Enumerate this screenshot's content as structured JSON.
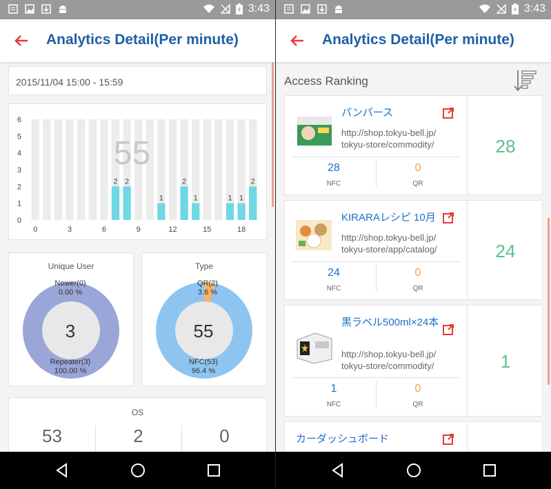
{
  "status_bar": {
    "time": "3:43"
  },
  "colors": {
    "accent_blue": "#1f5fa6",
    "back_red": "#e53935",
    "bar_cyan": "#6fd8e4",
    "donut_purple": "#9aa6d8",
    "donut_blue": "#8ec5f0",
    "donut_orange": "#f5b46a",
    "count_green": "#5cc08c",
    "nfc_blue": "#1f6fc6",
    "qr_orange": "#f0a040"
  },
  "icons": {
    "back": "arrow-left-icon",
    "sort": "sort-descending-icon",
    "external": "external-link-icon"
  },
  "left": {
    "title": "Analytics Detail(Per minute)",
    "date_range": "2015/11/04 15:00 - 15:59",
    "total_overlay": "55",
    "unique_user": {
      "title": "Unique User",
      "center": "3",
      "newer_label": "Newer(0)",
      "newer_pct": "0.00 %",
      "repeater_label": "Repeater(3)",
      "repeater_pct": "100.00 %"
    },
    "type": {
      "title": "Type",
      "center": "55",
      "qr_label": "QR(2)",
      "qr_pct": "3.6 %",
      "nfc_label": "NFC(53)",
      "nfc_pct": "96.4 %"
    },
    "os": {
      "title": "OS",
      "values": [
        "53",
        "2",
        "0"
      ]
    }
  },
  "chart_data": {
    "type": "bar",
    "x": [
      0,
      1,
      2,
      3,
      4,
      5,
      6,
      7,
      8,
      9,
      10,
      11,
      12,
      13,
      14,
      15,
      16,
      17,
      18,
      19
    ],
    "values": [
      0,
      0,
      0,
      0,
      0,
      0,
      0,
      2,
      2,
      0,
      0,
      1,
      0,
      2,
      1,
      0,
      0,
      1,
      1,
      2
    ],
    "xticks": [
      "0",
      "3",
      "6",
      "9",
      "12",
      "15",
      "18"
    ],
    "yticks": [
      "0",
      "1",
      "2",
      "3",
      "4",
      "5",
      "6"
    ],
    "ylim": [
      0,
      6
    ],
    "data_labels": true,
    "grid": false
  },
  "right": {
    "title": "Analytics Detail(Per minute)",
    "section_title": "Access Ranking",
    "items": [
      {
        "title": "パンパース",
        "url1": "http://shop.tokyu-bell.jp/",
        "url2": "tokyu-store/commodity/",
        "nfc": "28",
        "qr": "0",
        "nfc_label": "NFC",
        "qr_label": "QR",
        "count": "28"
      },
      {
        "title": "KIRARAレシピ 10月",
        "url1": "http://shop.tokyu-bell.jp/",
        "url2": "tokyu-store/app/catalog/",
        "nfc": "24",
        "qr": "0",
        "nfc_label": "NFC",
        "qr_label": "QR",
        "count": "24"
      },
      {
        "title": "黒ラベル500ml×24本",
        "url1": "http://shop.tokyu-bell.jp/",
        "url2": "tokyu-store/commodity/",
        "nfc": "1",
        "qr": "0",
        "nfc_label": "NFC",
        "qr_label": "QR",
        "count": "1"
      },
      {
        "title": "カーダッシュボード"
      }
    ]
  }
}
